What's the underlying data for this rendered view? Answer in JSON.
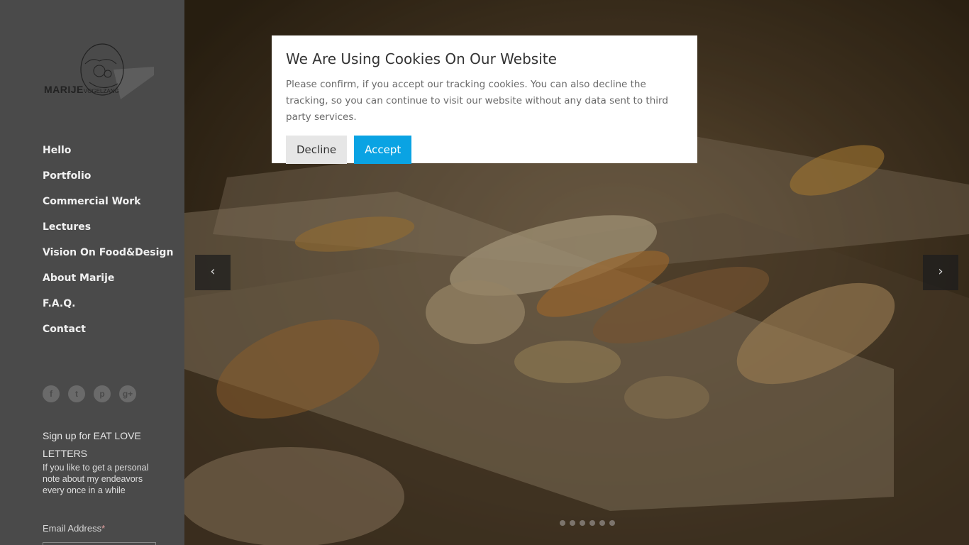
{
  "sidebar": {
    "logo": {
      "main": "MARIJE",
      "sub": "VOGELZANG"
    },
    "nav": [
      "Hello",
      "Portfolio",
      "Commercial Work",
      "Lectures",
      "Vision On Food&Design",
      "About Marije",
      "F.A.Q.",
      "Contact"
    ],
    "social": [
      {
        "icon": "facebook-icon",
        "glyph": "f"
      },
      {
        "icon": "twitter-icon",
        "glyph": "t"
      },
      {
        "icon": "pinterest-icon",
        "glyph": "p"
      },
      {
        "icon": "google-plus-icon",
        "glyph": "g+"
      }
    ],
    "newsletter": {
      "title": "Sign up for EAT LOVE LETTERS",
      "description": "If you like to get a personal note about my endeavors every once in a while",
      "email_label": "Email Address",
      "required_mark": "*"
    }
  },
  "slider": {
    "prev_glyph": "‹",
    "next_glyph": "›",
    "dot_count": 6
  },
  "cookie_modal": {
    "title": "We Are Using Cookies On Our Website",
    "text": "Please confirm, if you accept our tracking cookies. You can also decline the tracking, so you can continue to visit our website without any data sent to third party services.",
    "decline_label": "Decline",
    "accept_label": "Accept",
    "accept_color": "#0aa3e3"
  }
}
